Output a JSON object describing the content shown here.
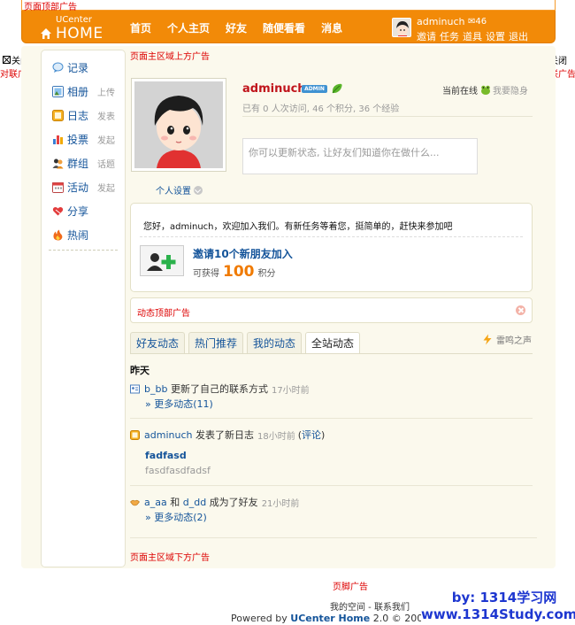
{
  "top_ad": "页面顶部广告",
  "header": {
    "logo_small": "UCenter",
    "logo_big": "HOME",
    "nav": [
      "首页",
      "个人主页",
      "好友",
      "随便看看",
      "消息"
    ],
    "username": "adminuch",
    "message_count": "46",
    "links": [
      "邀请",
      "任务",
      "道具",
      "设置",
      "退出"
    ]
  },
  "couplet": {
    "close": "关闭",
    "label": "对联广告"
  },
  "main_ad_top": "页面主区域上方广告",
  "main_ad_bottom": "页面主区域下方广告",
  "sidebar": {
    "items": [
      {
        "label": "记录",
        "sub": "",
        "icon": "speech-bubble-icon"
      },
      {
        "label": "相册",
        "sub": "上传",
        "icon": "photo-icon"
      },
      {
        "label": "日志",
        "sub": "发表",
        "icon": "blog-icon"
      },
      {
        "label": "投票",
        "sub": "发起",
        "icon": "poll-icon"
      },
      {
        "label": "群组",
        "sub": "话题",
        "icon": "group-icon"
      },
      {
        "label": "活动",
        "sub": "发起",
        "icon": "calendar-icon"
      },
      {
        "label": "分享",
        "sub": "",
        "icon": "share-icon"
      },
      {
        "label": "热闹",
        "sub": "",
        "icon": "fire-icon"
      }
    ]
  },
  "profile": {
    "name": "adminuch",
    "badge": "ADMIN",
    "online": "当前在线",
    "hide": "我要隐身",
    "stats": "已有 0 人次访问, 46 个积分, 36 个经验",
    "status_placeholder": "你可以更新状态, 让好友们知道你在做什么...",
    "settings": "个人设置"
  },
  "welcome": {
    "text": "您好，adminuch，欢迎加入我们。有新任务等着您，挺简单的，赶快来参加吧",
    "invite_title": "邀请10个新朋友加入",
    "reward_prefix": "可获得",
    "reward_value": "100",
    "reward_unit": "积分"
  },
  "feed_ad": "动态顶部广告",
  "tabs": [
    "好友动态",
    "热门推荐",
    "我的动态",
    "全站动态"
  ],
  "active_tab": "全站动态",
  "thunder": "雷鸣之声",
  "feed": {
    "day": "昨天",
    "item1": {
      "user": "b_bb",
      "action": "更新了自己的联系方式",
      "time": "17小时前",
      "more": "» 更多动态(11)"
    },
    "item2": {
      "user": "adminuch",
      "action": "发表了新日志",
      "time": "18小时前",
      "comment": "评论",
      "title": "fadfasd",
      "excerpt": "fasdfasdfadsf"
    },
    "item3": {
      "user1": "a_aa",
      "and": "和",
      "user2": "d_dd",
      "action": "成为了好友",
      "time": "21小时前",
      "more": "» 更多动态(2)"
    }
  },
  "footer": {
    "ad": "页脚广告",
    "links": "我的空间 - 联系我们",
    "powered_prefix": "Powered by",
    "powered_brand": "UCenter Home",
    "powered_suffix": "2.0 © 2001",
    "watermark1": "by:  1314学习网",
    "watermark2": "www.1314Study.com"
  }
}
